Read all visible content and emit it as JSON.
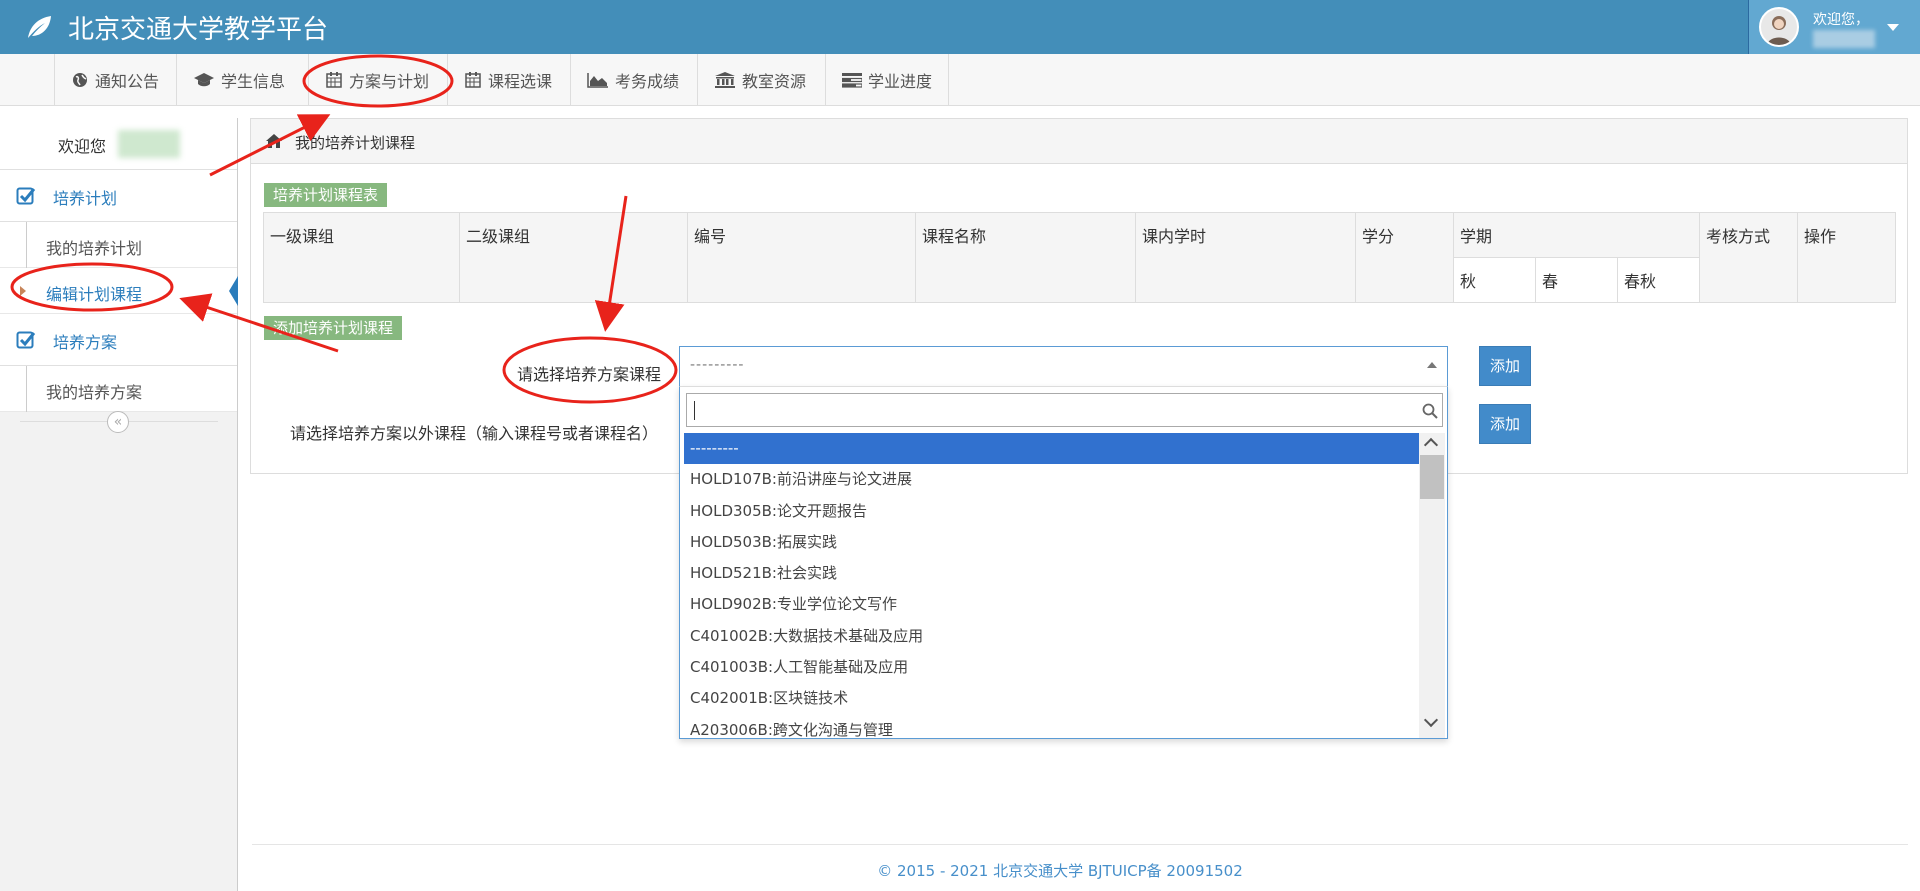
{
  "header": {
    "title": "北京交通大学教学平台",
    "user_welcome": "欢迎您，",
    "logo_icon": "leaf-icon",
    "accent": "#438eb9"
  },
  "nav": {
    "items": [
      {
        "label": "通知公告",
        "icon": "globe-icon"
      },
      {
        "label": "学生信息",
        "icon": "graduation-cap-icon"
      },
      {
        "label": "方案与计划",
        "icon": "calendar-icon"
      },
      {
        "label": "课程选课",
        "icon": "calendar-icon"
      },
      {
        "label": "考务成绩",
        "icon": "area-chart-icon"
      },
      {
        "label": "教室资源",
        "icon": "bank-icon"
      },
      {
        "label": "学业进度",
        "icon": "tasks-icon"
      }
    ]
  },
  "sidebar": {
    "welcome": "欢迎您",
    "groups": [
      {
        "label": "培养计划",
        "items": [
          "我的培养计划",
          "编辑计划课程"
        ]
      },
      {
        "label": "培养方案",
        "items": [
          "我的培养方案"
        ]
      }
    ],
    "active_item": "编辑计划课程"
  },
  "panel": {
    "title": "我的培养计划课程",
    "table_tag": "培养计划课程表",
    "table_headers": {
      "group1": "一级课组",
      "group2": "二级课组",
      "code": "编号",
      "name": "课程名称",
      "hours": "课内学时",
      "credits": "学分",
      "term": "学期",
      "term_fall": "秋",
      "term_spring": "春",
      "term_both": "春秋",
      "exam": "考核方式",
      "ops": "操作"
    },
    "add_tag": "添加培养计划课程",
    "select_label": "请选择培养方案课程",
    "select_value": "---------",
    "other_label": "请选择培养方案以外课程（输入课程号或者课程名）",
    "add_button": "添加",
    "add_button2": "添加"
  },
  "dropdown": {
    "options": [
      "---------",
      "HOLD107B:前沿讲座与论文进展",
      "HOLD305B:论文开题报告",
      "HOLD503B:拓展实践",
      "HOLD521B:社会实践",
      "HOLD902B:专业学位论文写作",
      "C401002B:大数据技术基础及应用",
      "C401003B:人工智能基础及应用",
      "C402001B:区块链技术",
      "A203006B:跨文化沟通与管理"
    ],
    "selected_index": 0
  },
  "footer": {
    "text": "© 2015 - 2021 北京交通大学 BJTUICP备 20091502"
  }
}
